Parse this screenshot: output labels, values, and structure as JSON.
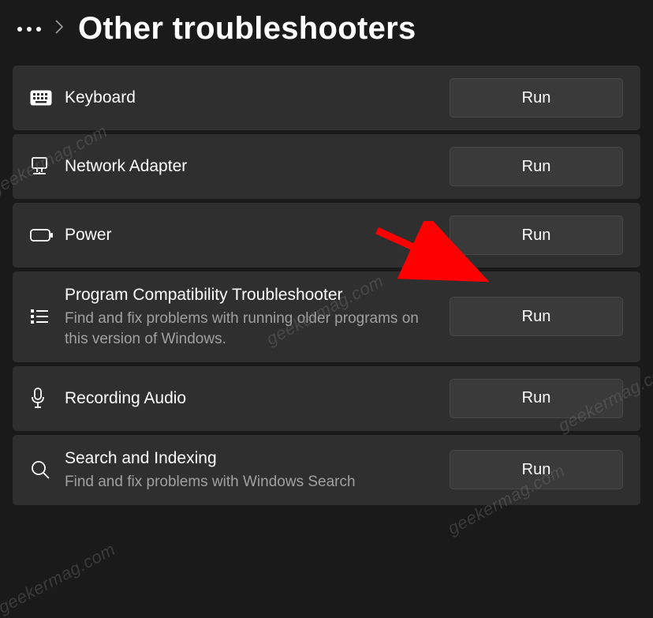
{
  "page": {
    "title": "Other troubleshooters",
    "run_label": "Run"
  },
  "troubleshooters": [
    {
      "id": "keyboard",
      "icon": "keyboard-icon",
      "label": "Keyboard",
      "desc": ""
    },
    {
      "id": "network-adapter",
      "icon": "network-adapter-icon",
      "label": "Network Adapter",
      "desc": ""
    },
    {
      "id": "power",
      "icon": "battery-icon",
      "label": "Power",
      "desc": ""
    },
    {
      "id": "program-compatibility",
      "icon": "list-icon",
      "label": "Program Compatibility Troubleshooter",
      "desc": "Find and fix problems with running older programs on this version of Windows."
    },
    {
      "id": "recording-audio",
      "icon": "microphone-icon",
      "label": "Recording Audio",
      "desc": ""
    },
    {
      "id": "search-indexing",
      "icon": "search-icon",
      "label": "Search and Indexing",
      "desc": "Find and fix problems with Windows Search"
    }
  ],
  "annotation": {
    "arrow_target": "power",
    "watermark": "geekermag.com"
  }
}
